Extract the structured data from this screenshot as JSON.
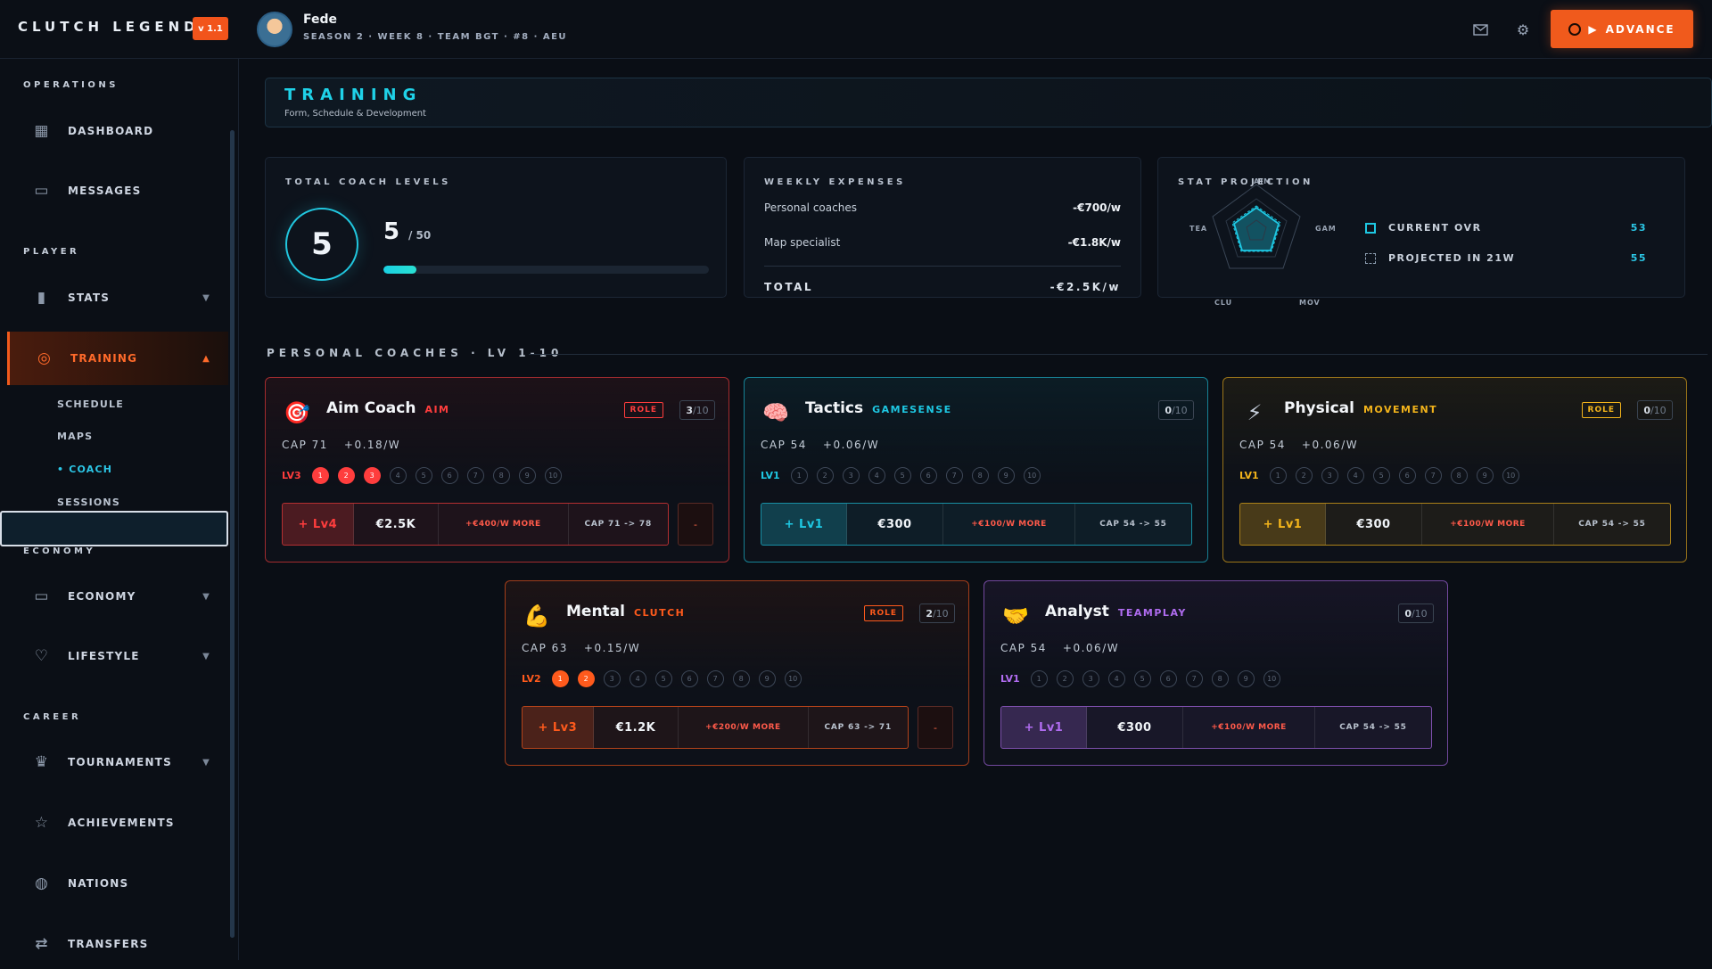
{
  "app": {
    "title": "CLUTCH LEGEND",
    "version": "v 1.1"
  },
  "user": {
    "name": "Fede",
    "subtitle": "SEASON 2 · WEEK 8 · TEAM BGT · #8 · AEU"
  },
  "header_actions": {
    "mail_icon": "mail-icon",
    "settings_icon": "gear-icon",
    "advance_label": "ADVANCE"
  },
  "sidebar": {
    "sections": {
      "operations": "OPERATIONS",
      "player": "PLAYER",
      "economy": "ECONOMY",
      "career": "CAREER"
    },
    "items": {
      "dashboard": "DASHBOARD",
      "messages": "MESSAGES",
      "stats": "STATS",
      "training": "TRAINING",
      "economy": "ECONOMY",
      "lifestyle": "LIFESTYLE",
      "tournaments": "TOURNAMENTS",
      "achievements": "ACHIEVEMENTS",
      "nations": "NATIONS",
      "transfers": "TRANSFERS"
    },
    "training_sub": {
      "schedule": "SCHEDULE",
      "maps": "MAPS",
      "coach": "• COACH",
      "sessions": "SESSIONS"
    }
  },
  "page": {
    "title": "TRAINING",
    "subtitle": "Form, Schedule & Development"
  },
  "coach_levels": {
    "label": "TOTAL COACH LEVELS",
    "value": "5",
    "max": "/ 50",
    "progress": 0.1
  },
  "expenses": {
    "label": "WEEKLY EXPENSES",
    "rows": [
      {
        "name": "Personal coaches",
        "value": "-€700/w"
      },
      {
        "name": "Map specialist",
        "value": "-€1.8K/w"
      }
    ],
    "total_label": "TOTAL",
    "total_value": "-€2.5K/w"
  },
  "projection": {
    "label": "STAT PROJECTION",
    "axes": [
      "AIM",
      "GAM",
      "MOV",
      "CLU",
      "TEA"
    ],
    "legend": [
      {
        "name": "CURRENT OVR",
        "value": "53"
      },
      {
        "name": "PROJECTED IN 21W",
        "value": "55"
      }
    ]
  },
  "coaches_section": "PERSONAL COACHES · LV 1-10",
  "coaches": [
    {
      "name": "Aim Coach",
      "tag": "AIM",
      "role": "ROLE",
      "count": "3",
      "count_max": "/10",
      "cap": "CAP 71",
      "gain": "+0.18/W",
      "level_label": "LV3",
      "level": 3,
      "buy": "+ Lv4",
      "price": "€2.5K",
      "more": "+€400/W MORE",
      "cap_change": "CAP 71 -> 78",
      "minus": "-",
      "color": "#ff3d3d",
      "emoji": "🎯"
    },
    {
      "name": "Tactics",
      "tag": "GAMESENSE",
      "role": "",
      "count": "0",
      "count_max": "/10",
      "cap": "CAP 54",
      "gain": "+0.06/W",
      "level_label": "LV1",
      "level": 0,
      "buy": "+ Lv1",
      "price": "€300",
      "more": "+€100/W MORE",
      "cap_change": "CAP 54 -> 55",
      "minus": "",
      "color": "#1ec8e3",
      "emoji": "🧠"
    },
    {
      "name": "Physical",
      "tag": "MOVEMENT",
      "role": "ROLE",
      "count": "0",
      "count_max": "/10",
      "cap": "CAP 54",
      "gain": "+0.06/W",
      "level_label": "LV1",
      "level": 0,
      "buy": "+ Lv1",
      "price": "€300",
      "more": "+€100/W MORE",
      "cap_change": "CAP 54 -> 55",
      "minus": "",
      "color": "#f3b41b",
      "emoji": "⚡"
    },
    {
      "name": "Mental",
      "tag": "CLUTCH",
      "role": "ROLE",
      "count": "2",
      "count_max": "/10",
      "cap": "CAP 63",
      "gain": "+0.15/W",
      "level_label": "LV2",
      "level": 2,
      "buy": "+ Lv3",
      "price": "€1.2K",
      "more": "+€200/W MORE",
      "cap_change": "CAP 63 -> 71",
      "minus": "-",
      "color": "#ff5a1c",
      "emoji": "💪"
    },
    {
      "name": "Analyst",
      "tag": "TEAMPLAY",
      "role": "",
      "count": "0",
      "count_max": "/10",
      "cap": "CAP 54",
      "gain": "+0.06/W",
      "level_label": "LV1",
      "level": 0,
      "buy": "+ Lv1",
      "price": "€300",
      "more": "+€100/W MORE",
      "cap_change": "CAP 54 -> 55",
      "minus": "",
      "color": "#b06cf0",
      "emoji": "🤝"
    }
  ]
}
